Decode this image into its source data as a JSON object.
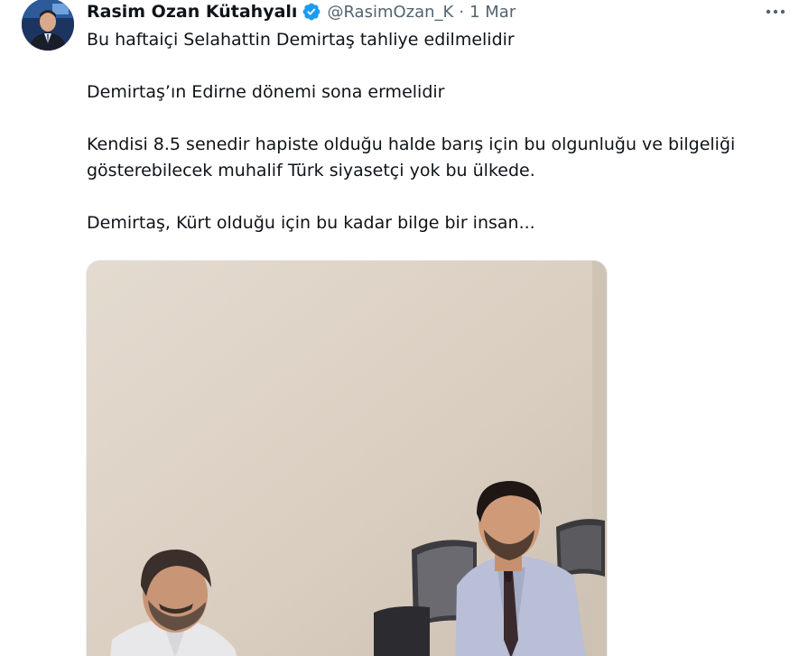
{
  "tweet": {
    "author": {
      "display_name": "Rasim Ozan Kütahyalı",
      "handle": "@RasimOzan_K",
      "verified": true
    },
    "separator": "·",
    "date": "1 Mar",
    "paragraphs": [
      "Bu haftaiçi Selahattin Demirtaş tahliye edilmelidir",
      "Demirtaş’ın Edirne dönemi sona ermelidir",
      "Kendisi 8.5 senedir hapiste olduğu halde barış için bu olgunluğu ve bilgeliği",
      "gösterebilecek muhalif Türk siyasetçi yok bu ülkede.",
      "Demirtaş, Kürt olduğu için bu kadar bilge bir insan..."
    ]
  },
  "colors": {
    "text": "#0f1419",
    "muted": "#536471",
    "verified_blue": "#1d9bf0",
    "media_wall": "#ddd2c6"
  },
  "icons": {
    "verified": "verified-badge-icon",
    "more": "more-options-icon"
  }
}
